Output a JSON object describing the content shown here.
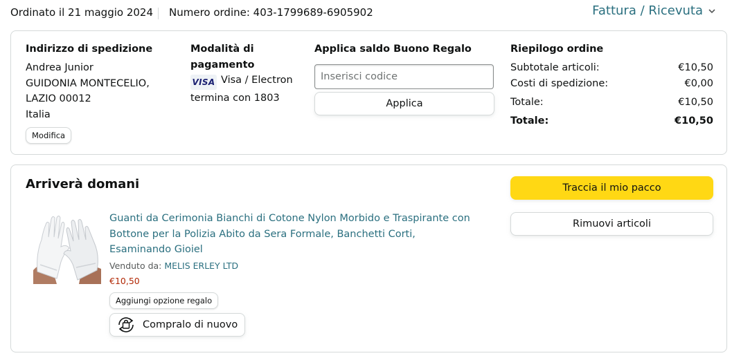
{
  "header": {
    "order_date": "Ordinato il 21 maggio 2024",
    "order_number": "Numero ordine: 403-1799689-6905902",
    "invoice_link": "Fattura / Ricevuta"
  },
  "shipping_address": {
    "heading": "Indirizzo di spedizione",
    "name": "Andrea Junior",
    "city": "GUIDONIA MONTECELIO,",
    "region_zip": "LAZIO 00012",
    "country": "Italia",
    "edit_label": "Modifica"
  },
  "payment": {
    "heading": "Modalità di pagamento",
    "card_brand_badge": "VISA",
    "card_type": "Visa / Electron",
    "ending": "termina con 1803"
  },
  "gift_card": {
    "heading": "Applica saldo Buono Regalo",
    "input_placeholder": "Inserisci codice",
    "input_value": "",
    "apply_label": "Applica"
  },
  "order_summary": {
    "heading": "Riepilogo ordine",
    "rows": [
      {
        "label": "Subtotale articoli:",
        "value": "€10,50"
      },
      {
        "label": "Costi di spedizione:",
        "value": "€0,00"
      },
      {
        "label": "Totale:",
        "value": "€10,50"
      },
      {
        "label": "Totale:",
        "value": "€10,50"
      }
    ]
  },
  "shipment": {
    "status": "Arriverà domani",
    "track_label": "Traccia il mio pacco",
    "remove_label": "Rimuovi articoli",
    "item": {
      "title": "Guanti da Cerimonia Bianchi di Cotone Nylon Morbido e Traspirante con Bottone per la Polizia Abito da Sera Formale, Banchetti Corti, Esaminando Gioiel",
      "sold_by_label": "Venduto da:",
      "seller": "MELIS ERLEY LTD",
      "price": "€10,50",
      "gift_option_label": "Aggiungi opzione regalo",
      "buy_again_label": "Compralo di nuovo",
      "image_icon": "white-gloves-image",
      "buy_again_icon": "rebuy-cycle-icon"
    }
  },
  "colors": {
    "link": "#2a6f7f",
    "price": "#b12704",
    "primary_button": "#ffd814",
    "border": "#d5d9d9",
    "text": "#0f1111"
  }
}
